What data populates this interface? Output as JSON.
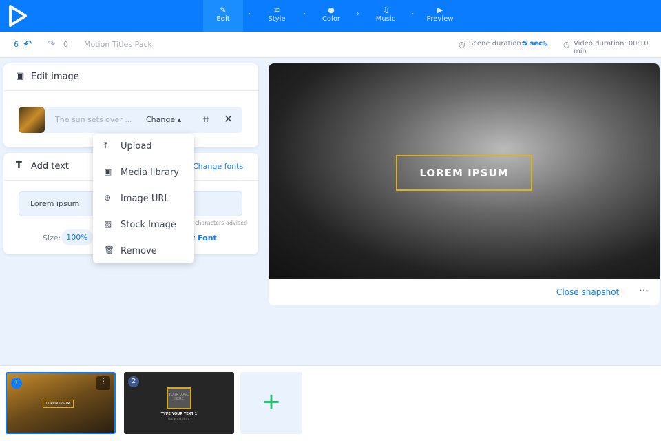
{
  "nav": {
    "steps": [
      {
        "label": "Edit",
        "icon": "pencil-icon"
      },
      {
        "label": "Style",
        "icon": "layers-icon"
      },
      {
        "label": "Color",
        "icon": "palette-icon"
      },
      {
        "label": "Music",
        "icon": "music-icon"
      },
      {
        "label": "Preview",
        "icon": "play-icon"
      }
    ]
  },
  "toolbar": {
    "undo_count": "6",
    "redo_count": "0",
    "project_title": "Motion Titles Pack",
    "scene_duration_label": "Scene duration:",
    "scene_duration_value": "5 sec",
    "video_duration": "Video duration: 00:10 min"
  },
  "edit_image": {
    "title": "Edit image",
    "caption_placeholder": "The sun sets over ...",
    "change_label": "Change"
  },
  "dropdown": {
    "items": [
      "Upload",
      "Media library",
      "Image URL",
      "Stock Image",
      "Remove"
    ]
  },
  "add_text": {
    "title": "Add text",
    "change_fonts": "Change fonts",
    "text_value": "Lorem ipsum",
    "hint": "characters advised",
    "size_label": "Size:",
    "size_value": "100%",
    "font_link": "t Font"
  },
  "preview": {
    "overlay_text": "LOREM IPSUM",
    "close_snapshot": "Close snapshot"
  },
  "scenes": [
    {
      "number": "1",
      "text": "LOREM IPSUM"
    },
    {
      "number": "2",
      "logo": "YOUR LOGO HERE",
      "text": "TYPE YOUR TEXT 1",
      "subtext": "TYPE YOUR TEXT 2"
    }
  ],
  "colors": {
    "brand": "#0a7cff",
    "add": "#1ec26a",
    "frame": "#e0b020"
  }
}
